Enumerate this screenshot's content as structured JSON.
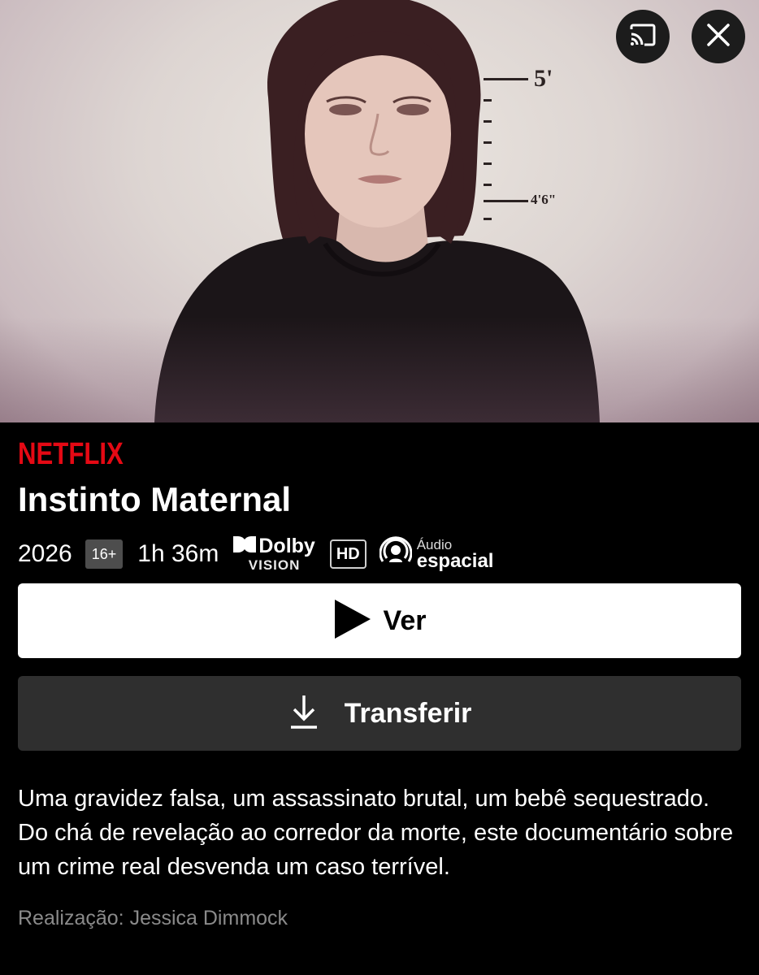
{
  "hero": {
    "ruler_top": "5'",
    "ruler_bottom": "4'6\""
  },
  "top_controls": {
    "cast_icon": "cast-icon",
    "close_icon": "close-icon"
  },
  "brand": "NETFLIX",
  "title": "Instinto Maternal",
  "meta": {
    "year": "2026",
    "rating": "16+",
    "duration": "1h 36m",
    "dolby_top": "Dolby",
    "dolby_bottom": "VISION",
    "hd": "HD",
    "audio_small": "Áudio",
    "audio_big": "espacial"
  },
  "buttons": {
    "play_label": "Ver",
    "download_label": "Transferir"
  },
  "description": "Uma gravidez falsa, um assassinato brutal, um bebê sequestrado. Do chá de revelação ao corredor da morte, este documentário sobre um crime real desvenda um caso terrível.",
  "director": "Realização: Jessica Dimmock",
  "colors": {
    "brand_red": "#e50914",
    "background": "#000000",
    "download_button": "#2f2f2f",
    "rating_badge": "#4d4d4d"
  }
}
